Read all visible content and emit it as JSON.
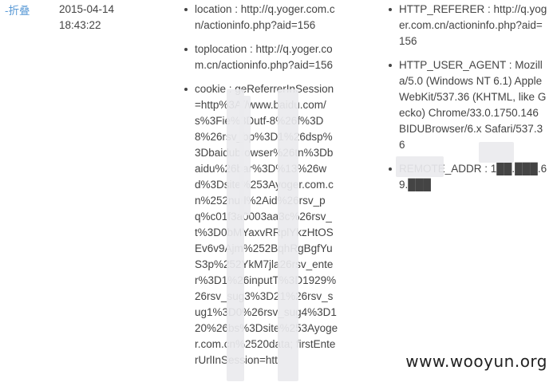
{
  "row": {
    "fold_label": "-折叠",
    "date": "2015-04-14",
    "time": "18:43:22"
  },
  "fields_mid": [
    {
      "text": "location : http://q.yoger.com.cn/actioninfo.php?aid=156"
    },
    {
      "text": "toplocation : http://q.yoger.com.cn/actioninfo.php?aid=156"
    },
    {
      "text": "cookie : geReferrerInSession=http%3A//www.baidu.com/s%3Fie%3Dutf-8%26f%3D8%26rsv_bp%3D1%26dsp%3Dbaidubrowser%26tn%3Dbaidu%26bar%3D%13%26wd%3Dsite%253Ayoger.com.cn%252nurl%2Aid%26rsv_pq%c01f3a0003aa3c%26rsv_t%3D0bMYaxvRRplYkzHtOSEv6v9Ajm%252BqhRgBgfYuS3p%252YkM7jla26rsv_enter%3D1%26inputT%3D1929%26rsv_sug3%3D21%26rsv_sug1%3D0%26rsv_sug4%3D120%26bs%3Dsite%253Ayoger.com.cn%2520data; firstEnterUrlInSession=htt"
    }
  ],
  "fields_right": [
    {
      "text": "HTTP_REFERER : http://q.yoger.com.cn/actioninfo.php?aid=156"
    },
    {
      "text": "HTTP_USER_AGENT : Mozilla/5.0 (Windows NT 6.1) AppleWebKit/537.36 (KHTML, like Gecko) Chrome/33.0.1750.146 BIDUBrowser/6.x Safari/537.36"
    },
    {
      "text": "REMOTE_ADDR : 1██.███.69.███"
    }
  ],
  "watermark": "www.wooyun.org"
}
